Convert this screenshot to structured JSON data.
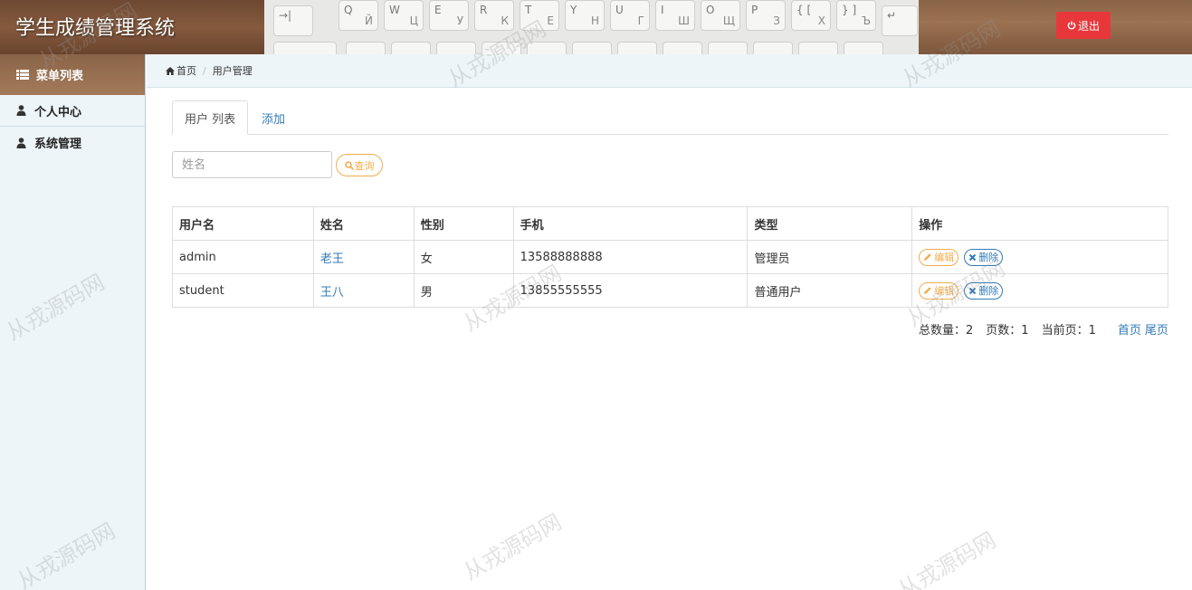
{
  "app": {
    "title": "学生成绩管理系统",
    "logout_label": "退出"
  },
  "keyboard": {
    "keys": [
      {
        "top": "→|",
        "sub": ""
      },
      {
        "top": "Q",
        "sub": "Й"
      },
      {
        "top": "W",
        "sub": "Ц"
      },
      {
        "top": "E",
        "sub": "У"
      },
      {
        "top": "R",
        "sub": "К"
      },
      {
        "top": "T",
        "sub": "Е"
      },
      {
        "top": "Y",
        "sub": "Н"
      },
      {
        "top": "U",
        "sub": "Г"
      },
      {
        "top": "I",
        "sub": "Ш"
      },
      {
        "top": "O",
        "sub": "Щ"
      },
      {
        "top": "P",
        "sub": "З"
      },
      {
        "top": "{ [",
        "sub": "Х"
      },
      {
        "top": "} ]",
        "sub": "Ъ"
      },
      {
        "top": "↵",
        "sub": ""
      }
    ]
  },
  "sidebar": {
    "header": "菜单列表",
    "items": [
      {
        "label": "个人中心"
      },
      {
        "label": "系统管理"
      }
    ]
  },
  "breadcrumb": {
    "home": "首页",
    "current": "用户管理"
  },
  "tabs": {
    "list": "用户 列表",
    "add": "添加"
  },
  "search": {
    "placeholder": "姓名",
    "button": "查询"
  },
  "table": {
    "headers": [
      "用户名",
      "姓名",
      "性别",
      "手机",
      "类型",
      "操作"
    ],
    "rows": [
      {
        "username": "admin",
        "name": "老王",
        "gender": "女",
        "phone": "13588888888",
        "type": "管理员"
      },
      {
        "username": "student",
        "name": "王八",
        "gender": "男",
        "phone": "13855555555",
        "type": "普通用户"
      }
    ],
    "edit_label": "编辑",
    "delete_label": "删除"
  },
  "pager": {
    "total_label": "总数量：2",
    "pages_label": "页数：1",
    "current_label": "当前页：1",
    "first": "首页",
    "last": "尾页"
  },
  "watermark": "从戎源码网",
  "colors": {
    "logout": "#e8373a",
    "link": "#337ab7",
    "warning": "#f0ad4e"
  }
}
